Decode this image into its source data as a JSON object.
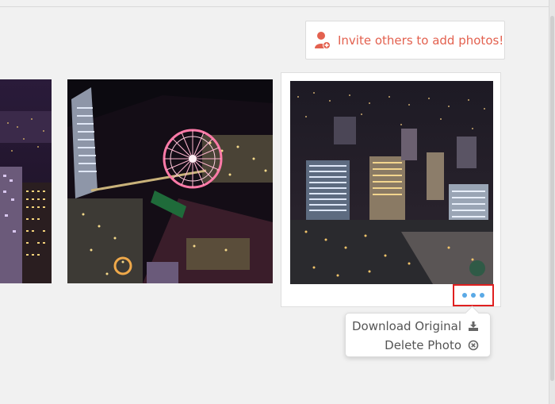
{
  "invite": {
    "label": "Invite others to add photos!",
    "icon": "add-user-icon",
    "color": "#e3614f"
  },
  "photos": [
    {
      "name": "photo-left",
      "description": ""
    },
    {
      "name": "photo-ferris-wheel",
      "description": ""
    },
    {
      "name": "photo-city-skyline",
      "description": ""
    }
  ],
  "more_button": {
    "icon": "more-dots-icon",
    "accent": "#5aa9e6",
    "highlight": "#e02020"
  },
  "menu": {
    "items": [
      {
        "label": "Download Original",
        "icon": "download-icon"
      },
      {
        "label": "Delete Photo",
        "icon": "delete-circle-icon"
      }
    ]
  }
}
